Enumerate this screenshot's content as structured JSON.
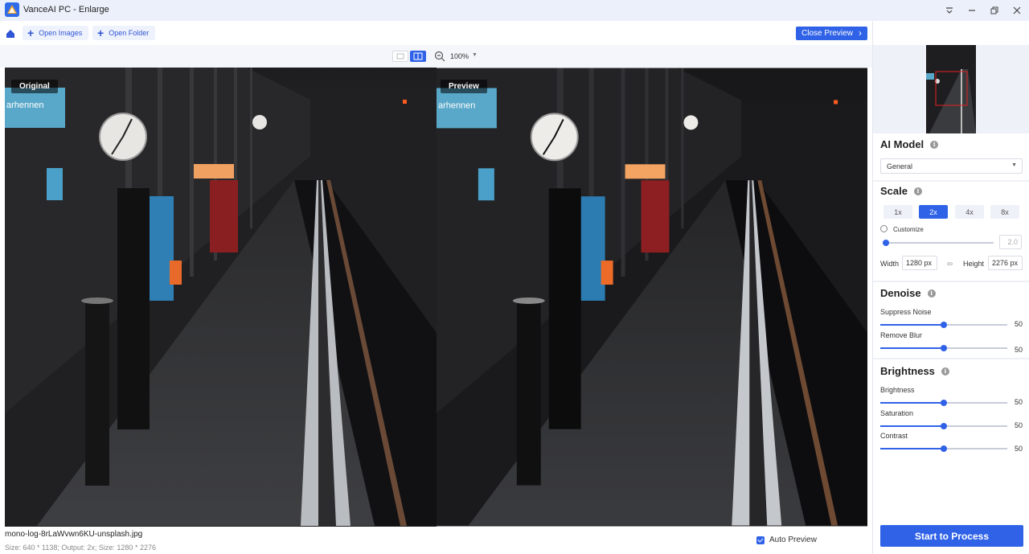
{
  "window": {
    "title": "VanceAI PC - Enlarge"
  },
  "toolbar": {
    "open_images": "Open Images",
    "open_folder": "Open Folder",
    "close_preview": "Close Preview"
  },
  "view": {
    "zoom": "100%"
  },
  "panes": {
    "original_label": "Original",
    "preview_label": "Preview",
    "sign_text": "arhennen"
  },
  "footer": {
    "filename": "mono-log-8rLaWvwn6KU-unsplash.jpg",
    "meta": "Size: 640 * 1138; Output: 2x; Size: 1280 * 2276",
    "auto_preview": "Auto Preview"
  },
  "ai_model": {
    "title": "AI Model",
    "selected": "General"
  },
  "scale": {
    "title": "Scale",
    "options": [
      "1x",
      "2x",
      "4x",
      "8x"
    ],
    "active": "2x",
    "customize_label": "Customize",
    "customize_value": "2.0",
    "customize_level": 0.0,
    "width_label": "Width",
    "width_value": "1280 px",
    "height_label": "Height",
    "height_value": "2276 px"
  },
  "denoise": {
    "title": "Denoise",
    "suppress_label": "Suppress Noise",
    "suppress_value": "50",
    "blur_label": "Remove Blur",
    "blur_value": "50"
  },
  "brightness": {
    "title": "Brightness",
    "brightness_label": "Brightness",
    "brightness_value": "50",
    "saturation_label": "Saturation",
    "saturation_value": "50",
    "contrast_label": "Contrast",
    "contrast_value": "50"
  },
  "actions": {
    "start": "Start to Process"
  },
  "colors": {
    "accent": "#3062e8",
    "titlebar": "#ecf0fb"
  }
}
